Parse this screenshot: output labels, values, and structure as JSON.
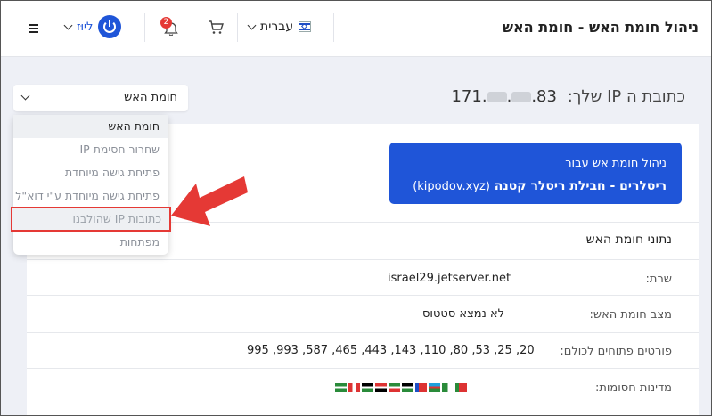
{
  "header": {
    "title": "ניהול חומת האש - חומת האש",
    "language": "עברית",
    "brand": "ליוּז",
    "notifications_count": "2"
  },
  "ip": {
    "label": "כתובת ה IP שלך:",
    "value": "83.▒▒.▒▒.171"
  },
  "select": {
    "value": "חומת האש"
  },
  "menu": {
    "items": [
      "חומת האש",
      "שחרור חסימת IP",
      "פתיחת גישה מיוחדת",
      "פתיחת גישה מיוחדת ע\"י דוא\"ל",
      "כתובות IP שהולבנו",
      "מפתחות"
    ]
  },
  "promo": {
    "line1": "ניהול חומת אש עבור",
    "line2": "ריסלרים - חבילת ריסלר קטנה",
    "domain": "(kipodov.xyz)"
  },
  "details": {
    "section_title": "נתוני חומת האש",
    "rows": [
      {
        "label": "שרת:",
        "value": "israel29.jetserver.net"
      },
      {
        "label": "מצב חומת האש:",
        "value": "לא נמצא סטטוס"
      },
      {
        "label": "פורטים פתוחים לכולם:",
        "value": "20, 25, 53, 80, 110, 143, 443, 465, 587, 993, 995"
      },
      {
        "label": "מדינות חסומות:",
        "value": ""
      }
    ]
  },
  "colors": {
    "accent": "#1f55d8",
    "highlight": "#e53935",
    "background": "#eef0f6"
  },
  "icons": [
    "israel-flag-icon",
    "cart-icon",
    "bell-icon",
    "power-logo-icon",
    "hamburger-icon",
    "chevron-down-icon"
  ]
}
